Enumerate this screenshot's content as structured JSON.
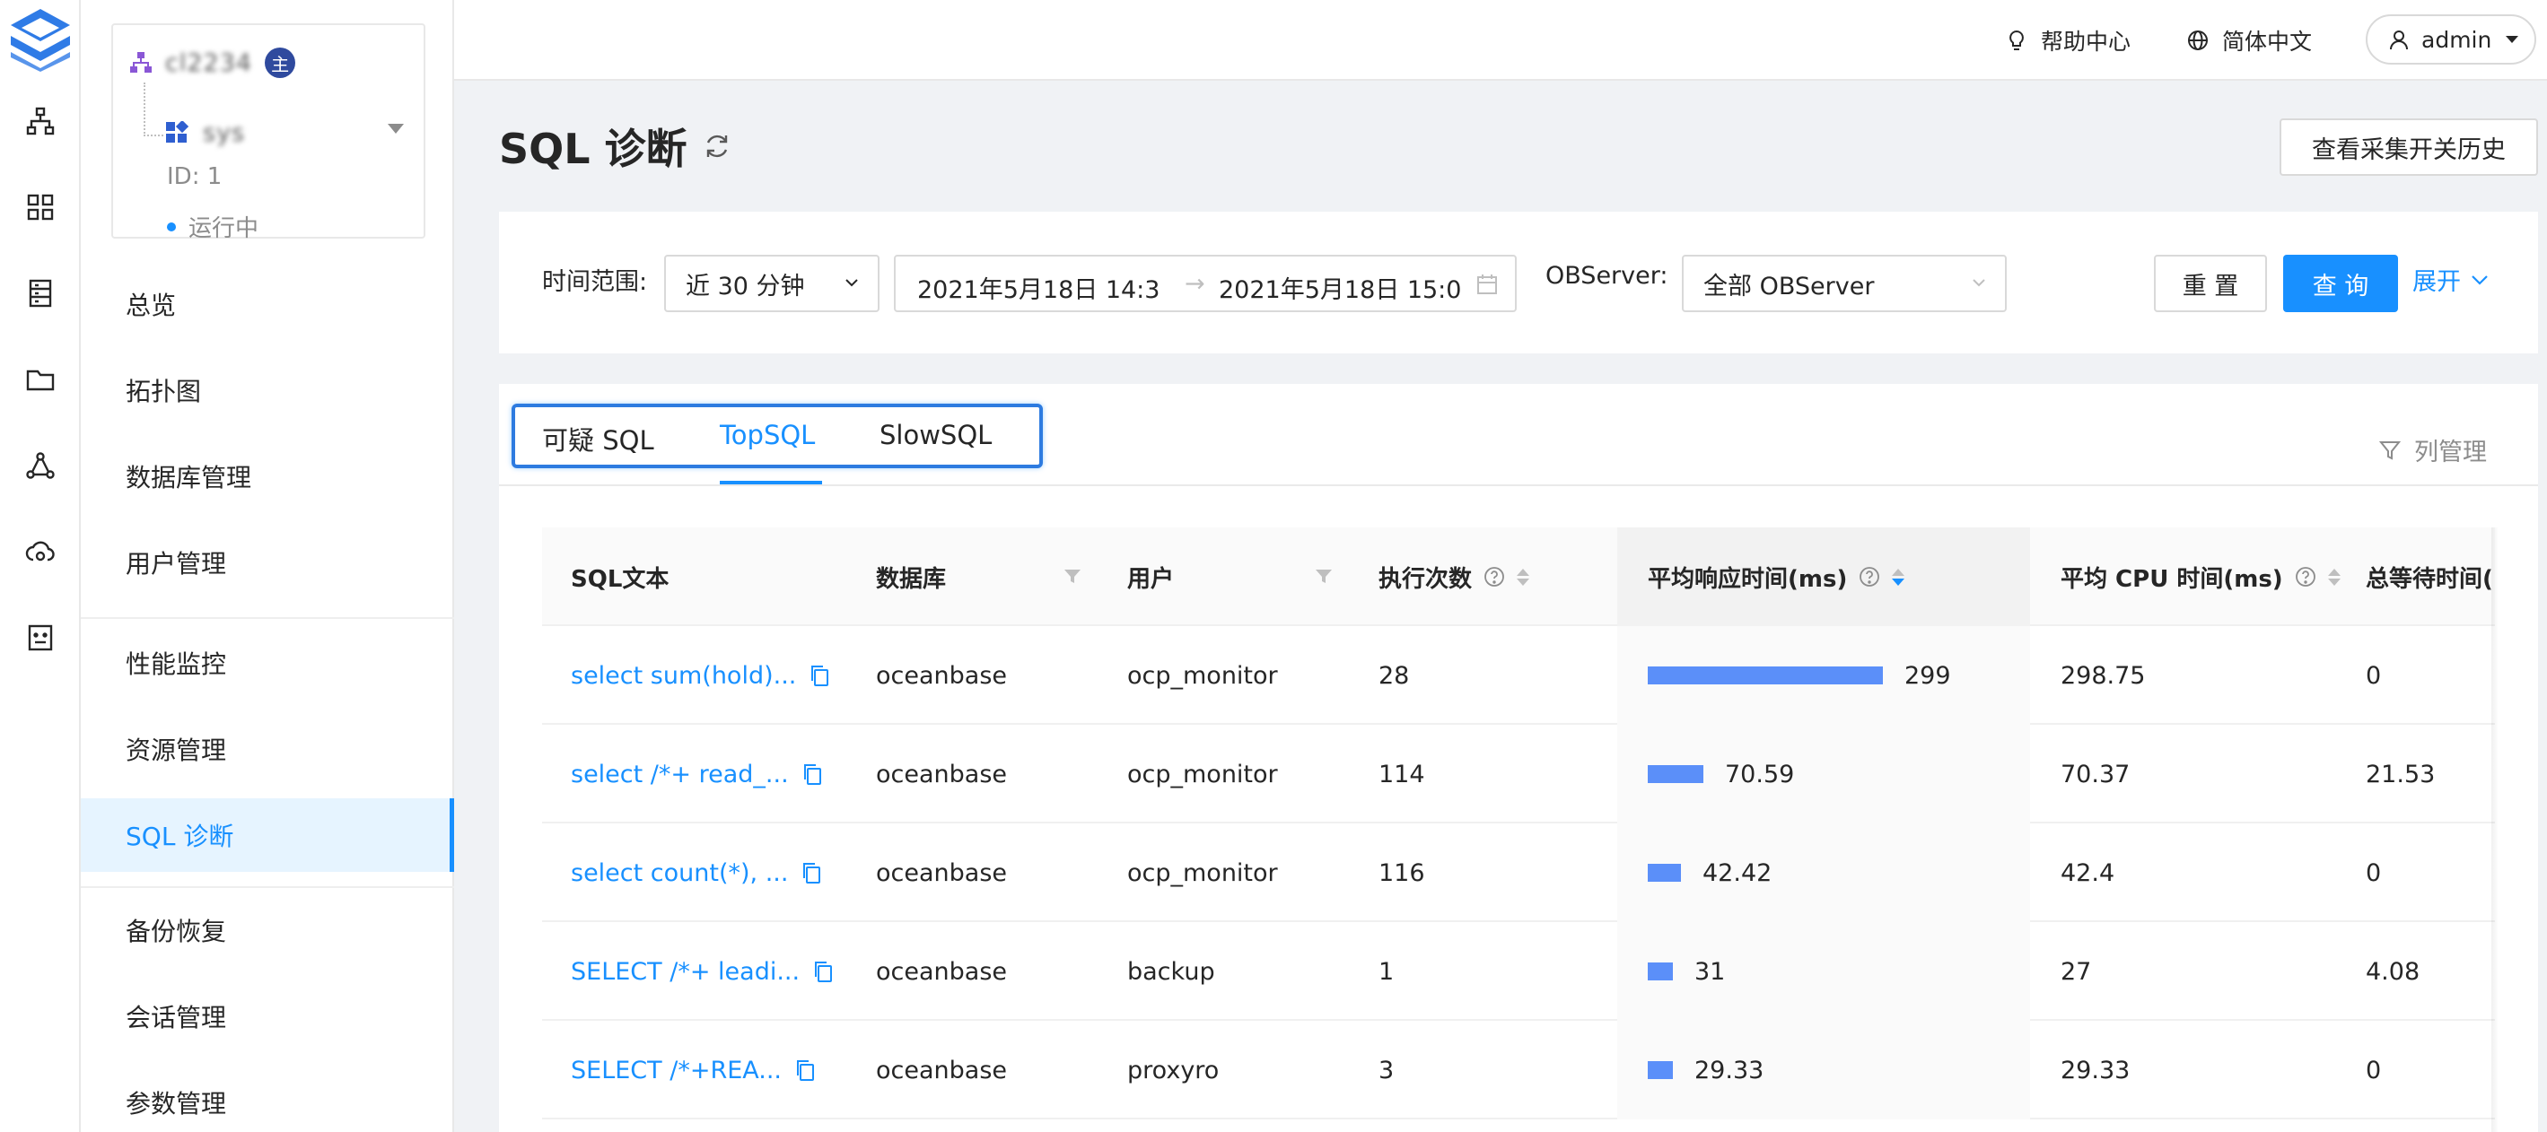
{
  "cluster": {
    "name_blurred": "cl2234",
    "main_badge": "主",
    "tenant_blurred": "sys",
    "id_text": "ID: 1",
    "status": "运行中"
  },
  "menu": [
    {
      "label": "总览"
    },
    {
      "label": "拓扑图"
    },
    {
      "label": "数据库管理"
    },
    {
      "label": "用户管理"
    },
    {
      "label": "性能监控"
    },
    {
      "label": "资源管理"
    },
    {
      "label": "SQL 诊断"
    },
    {
      "label": "备份恢复"
    },
    {
      "label": "会话管理"
    },
    {
      "label": "参数管理"
    }
  ],
  "header": {
    "help": "帮助中心",
    "language": "简体中文",
    "user": "admin"
  },
  "page": {
    "title": "SQL 诊断",
    "history_button": "查看采集开关历史"
  },
  "filters": {
    "time_label": "时间范围:",
    "time_value": "近 30 分钟",
    "range_start": "2021年5月18日 14:3",
    "range_sep": "→",
    "range_end": "2021年5月18日 15:0",
    "observer_label": "OBServer:",
    "observer_value": "全部 OBServer",
    "reset": "重 置",
    "query": "查 询",
    "expand": "展开"
  },
  "tabs": {
    "items": [
      "可疑 SQL",
      "TopSQL",
      "SlowSQL"
    ],
    "active": "TopSQL",
    "column_manager": "列管理"
  },
  "table": {
    "columns": [
      "SQL文本",
      "数据库",
      "用户",
      "执行次数",
      "平均响应时间(ms)",
      "平均 CPU 时间(ms)",
      "总等待时间("
    ],
    "rows": [
      {
        "sql": "select sum(hold)...",
        "db": "oceanbase",
        "user": "ocp_monitor",
        "count": "28",
        "avg_rt": "299",
        "avg_rt_value": 299,
        "avg_cpu": "298.75",
        "wait": "0"
      },
      {
        "sql": "select /*+ read_...",
        "db": "oceanbase",
        "user": "ocp_monitor",
        "count": "114",
        "avg_rt": "70.59",
        "avg_rt_value": 70.59,
        "avg_cpu": "70.37",
        "wait": "21.53"
      },
      {
        "sql": "select count(*), ...",
        "db": "oceanbase",
        "user": "ocp_monitor",
        "count": "116",
        "avg_rt": "42.42",
        "avg_rt_value": 42.42,
        "avg_cpu": "42.4",
        "wait": "0"
      },
      {
        "sql": "SELECT /*+ leadi...",
        "db": "oceanbase",
        "user": "backup",
        "count": "1",
        "avg_rt": "31",
        "avg_rt_value": 31,
        "avg_cpu": "27",
        "wait": "4.08"
      },
      {
        "sql": "SELECT /*+REA...",
        "db": "oceanbase",
        "user": "proxyro",
        "count": "3",
        "avg_rt": "29.33",
        "avg_rt_value": 29.33,
        "avg_cpu": "29.33",
        "wait": "0"
      }
    ],
    "bar_max": 299
  },
  "colors": {
    "primary": "#1890ff",
    "bar": "#5b8ff9",
    "badge": "#2f4a9e"
  },
  "icons": {
    "rail": [
      "logo-icon",
      "topology-icon",
      "grid-icon",
      "database-icon",
      "folder-icon",
      "cluster-node-icon",
      "cloud-icon",
      "robot-icon"
    ]
  }
}
